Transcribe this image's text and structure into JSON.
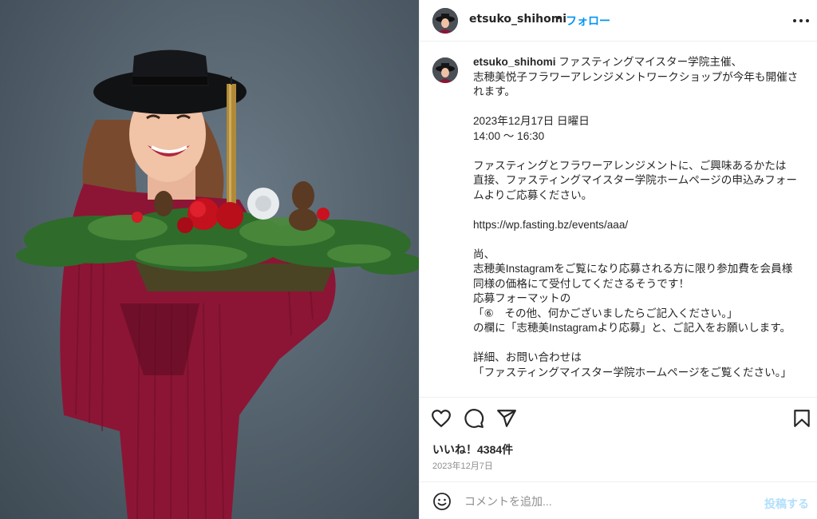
{
  "post": {
    "image_alt": "Woman in black hat and red velvet suit holding a Christmas flower arrangement with a gold candle"
  },
  "header": {
    "username": "etsuko_shihomi",
    "separator": "•",
    "follow_label": "フォロー",
    "more_icon": "more-options-icon"
  },
  "caption": {
    "username": "etsuko_shihomi",
    "text": " ファスティングマイスター学院主催、\n志穂美悦子フラワーアレンジメントワークショップが今年も開催されます。\n\n2023年12月17日 日曜日\n14:00 〜 16:30\n\nファスティングとフラワーアレンジメントに、ご興味あるかたは\n直接、ファスティングマイスター学院ホームページの申込みフォームよりご応募ください。\n\nhttps://wp.fasting.bz/events/aaa/\n\n尚、\n志穂美Instagramをご覧になり応募される方に限り参加費を会員様同様の価格にて受付してくださるそうです！\n応募フォーマットの\n「⑥　その他、何かございましたらご記入ください。」\nの欄に「志穂美Instagramより応募」と、ご記入をお願いします。\n\n詳細、お問い合わせは\n「ファスティングマイスター学院ホームページをご覧ください。」"
  },
  "actions": {
    "like_icon": "heart-icon",
    "comment_icon": "comment-icon",
    "share_icon": "share-icon",
    "save_icon": "bookmark-icon"
  },
  "likes": {
    "label": "いいね！4384件"
  },
  "date": {
    "label": "2023年12月7日"
  },
  "comment_box": {
    "emoji_icon": "emoji-icon",
    "placeholder": "コメントを追加...",
    "post_label": "投稿する"
  },
  "colors": {
    "accent": "#0095f6",
    "post_disabled": "#b2dffc",
    "text": "#262626",
    "muted": "#8e8e8e",
    "divider": "#efefef"
  }
}
